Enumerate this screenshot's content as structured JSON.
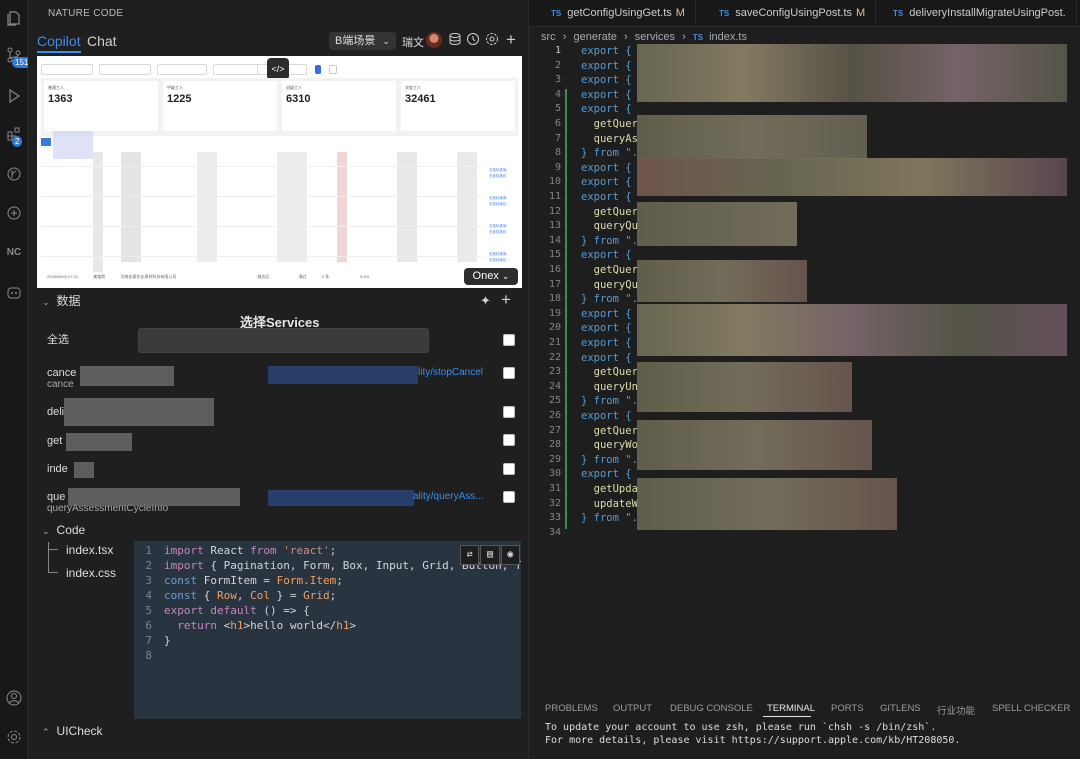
{
  "activity_bar": {
    "source_control_badge": "151",
    "extensions_badge": "2",
    "nc_label": "NC"
  },
  "left_panel": {
    "title": "NATURE CODE",
    "tabs": [
      "Copilot",
      "Chat"
    ],
    "scene_select": "B端场景",
    "user_name": "瑞文",
    "preview": {
      "cards": [
        {
          "label": "普通工人",
          "value": "1363"
        },
        {
          "label": "中级工人",
          "value": "1225"
        },
        {
          "label": "初级工人",
          "value": "6310"
        },
        {
          "label": "学徒工人",
          "value": "32461"
        }
      ],
      "links": [
        "无效标准库",
        "无效标准化"
      ],
      "bottom_row": [
        "2018/08/03 07:12",
        "美猫商",
        "河南宏意实业建材科技有限公司",
        "服务区",
        "通过",
        "0 条",
        "6.0%"
      ],
      "onex_label": "Onex"
    },
    "data_section": {
      "title": "数据",
      "services_title": "选择Services",
      "select_all": "全选",
      "rows": [
        {
          "label": "cance",
          "sub": "cance",
          "path": "lity/stopCancel"
        },
        {
          "label": "deli",
          "sub": "",
          "path": ""
        },
        {
          "label": "get",
          "sub": "",
          "path": ""
        },
        {
          "label": "inde",
          "sub": "",
          "path": ""
        },
        {
          "label": "que",
          "sub": "queryAssessmentCycleInfo",
          "path": "ality/queryAss..."
        }
      ]
    },
    "code_section": {
      "title": "Code",
      "files": [
        "index.tsx",
        "index.css"
      ]
    },
    "mini_editor": {
      "lines": [
        {
          "n": "1",
          "text": "import React from 'react';"
        },
        {
          "n": "2",
          "text": "import { Pagination, Form, Box, Input, Grid, Button, Tab"
        },
        {
          "n": "3",
          "text": "const FormItem = Form.Item;"
        },
        {
          "n": "4",
          "text": "const { Row, Col } = Grid;"
        },
        {
          "n": "5",
          "text": "export default () => {"
        },
        {
          "n": "6",
          "text": "  return <h1>hello world</h1>"
        },
        {
          "n": "7",
          "text": "}"
        },
        {
          "n": "8",
          "text": ""
        }
      ]
    },
    "uicheck_title": "UICheck"
  },
  "editor": {
    "tabs": [
      {
        "name": "getConfigUsingGet.ts",
        "mod": "M"
      },
      {
        "name": "saveConfigUsingPost.ts",
        "mod": "M"
      },
      {
        "name": "deliveryInstallMigrateUsingPost.",
        "mod": ""
      }
    ],
    "breadcrumb": [
      "src",
      "generate",
      "services",
      "index.ts"
    ],
    "line_numbers": [
      "1",
      "2",
      "3",
      "4",
      "5",
      "6",
      "7",
      "8",
      "9",
      "10",
      "11",
      "12",
      "13",
      "14",
      "15",
      "16",
      "17",
      "18",
      "19",
      "20",
      "21",
      "22",
      "23",
      "24",
      "25",
      "26",
      "27",
      "28",
      "29",
      "30",
      "31",
      "32",
      "33",
      "34"
    ],
    "code_lines": [
      "export { ",
      "export { ",
      "export { ",
      "export { ",
      "export {",
      "  getQuer",
      "  queryAs",
      "} from \".",
      "export { ",
      "export { ",
      "export {",
      "  getQuer",
      "  queryQu",
      "} from \".",
      "export {",
      "  getQuer",
      "  queryQu",
      "} from \".",
      "export { ",
      "export { ",
      "export { ",
      "export {",
      "  getQuer",
      "  queryUn",
      "} from \".",
      "export {",
      "  getQuer",
      "  queryWo",
      "} from \".",
      "export {",
      "  getUpda",
      "  updateW",
      "} from \".",
      ""
    ]
  },
  "bottom_panel": {
    "tabs": [
      "PROBLEMS",
      "OUTPUT",
      "DEBUG CONSOLE",
      "TERMINAL",
      "PORTS",
      "GITLENS",
      "行业功能",
      "SPELL CHECKER"
    ],
    "active_tab": "TERMINAL",
    "terminal_lines": [
      "To update your account to use zsh, please run `chsh -s /bin/zsh`.",
      "For more details, please visit https://support.apple.com/kb/HT208050."
    ]
  }
}
